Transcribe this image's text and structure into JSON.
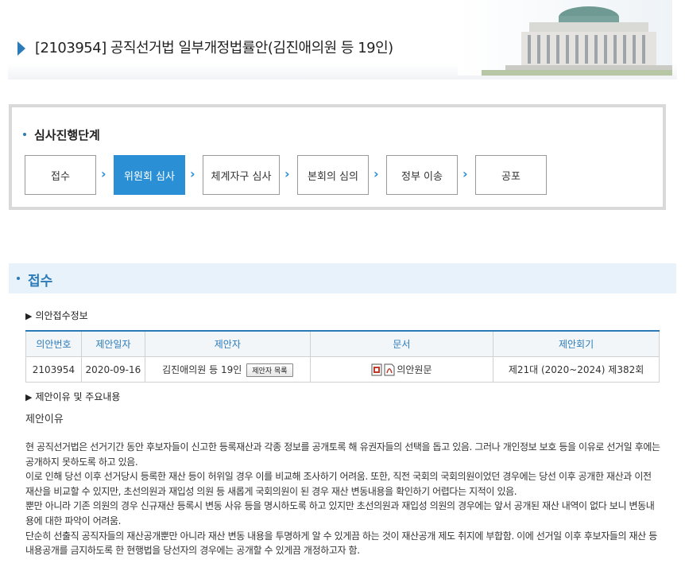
{
  "header": {
    "title": "[2103954] 공직선거법 일부개정법률안(김진애의원 등 19인)"
  },
  "stages": {
    "heading": "심사진행단계",
    "steps": [
      {
        "label": "접수",
        "active": false
      },
      {
        "label": "위원회 심사",
        "active": true
      },
      {
        "label": "체계자구 심사",
        "active": false
      },
      {
        "label": "본회의 심의",
        "active": false
      },
      {
        "label": "정부 이송",
        "active": false
      },
      {
        "label": "공포",
        "active": false
      }
    ],
    "separator": "›"
  },
  "section": {
    "title": "접수"
  },
  "receipt_info": {
    "heading": "의안접수정보",
    "columns": [
      "의안번호",
      "제안일자",
      "제안자",
      "문서",
      "제안회기"
    ],
    "row": {
      "bill_no": "2103954",
      "date": "2020-09-16",
      "proposer": "김진애의원 등 19인",
      "proposer_button": "제안자 목록",
      "doc": "의안원문",
      "session": "제21대 (2020~2024) 제382회"
    }
  },
  "content": {
    "heading": "제안이유 및 주요내용",
    "reason_title": "제안이유",
    "paragraphs": [
      "현 공직선거법은 선거기간 동안 후보자들이 신고한 등록재산과 각종 정보를 공개토록 해 유권자들의 선택을 돕고 있음. 그러나 개인정보 보호 등을 이유로 선거일 후에는 공개하지 못하도록 하고 있음.",
      "이로 인해 당선 이후 선거당시 등록한 재산 등이 허위일 경우 이를 비교해 조사하기 어려움. 또한, 직전 국회의 국회의원이었던 경우에는 당선 이후 공개한 재산과 이전 재산을 비교할 수 있지만, 초선의원과 재입성 의원 등 새롭게 국회의원이 된 경우 재산 변동내용을 확인하기 어렵다는 지적이 있음.",
      "뿐만 아니라 기존 의원의 경우 신규재산 등록시 변동 사유 등을 명시하도록 하고 있지만 초선의원과 재입성 의원의 경우에는 앞서 공개된 재산 내역이 없다 보니 변동내용에 대한 파악이 어려움.",
      "단순히 선출직 공직자들의 재산공개뿐만 아니라 재산 변동 내용을 투명하게 알 수 있게끔 하는 것이 재산공개 제도 취지에 부합함. 이에 선거일 이후 후보자들의 재산 등 내용공개를 금지하도록 한 현행법을 당선자의 경우에는 공개할 수 있게끔 개정하고자 함."
    ]
  },
  "colors": {
    "accent": "#2b7bb9",
    "active_step": "#2b8fd6",
    "section_bg": "#e8f2fb"
  },
  "icons": [
    "arrow-right-icon",
    "hwp-file-icon",
    "pdf-file-icon",
    "chevron-right-icon"
  ]
}
